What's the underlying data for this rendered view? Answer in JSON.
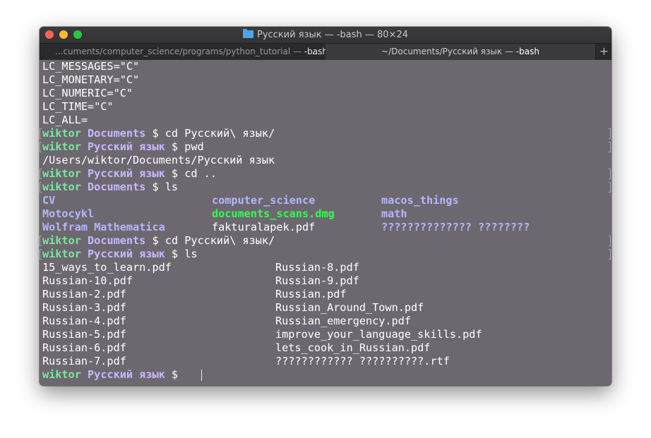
{
  "window": {
    "title": "Русский язык — -bash — 80×24",
    "folder_icon": "folder-icon"
  },
  "tabs": [
    {
      "label_path": "...cuments/computer_science/programs/python_tutorial — ",
      "label_cmd": "-bash",
      "active": false,
      "more": "..."
    },
    {
      "label_path": "~/Documents/Русский язык — ",
      "label_cmd": "-bash",
      "active": true
    }
  ],
  "new_tab_label": "+",
  "terminal": {
    "lines": {
      "l1": "LC_MESSAGES=\"C\"",
      "l2": "LC_MONETARY=\"C\"",
      "l3": "LC_NUMERIC=\"C\"",
      "l4": "LC_TIME=\"C\"",
      "l5": "LC_ALL=",
      "p1_user": "wiktor",
      "p1_dir": "Documents",
      "p1_cmd": "$ cd Русский\\ язык/",
      "p2_user": "wiktor",
      "p2_dir": "Русский язык",
      "p2_cmd": "$ pwd",
      "pwd_out": "/Users/wiktor/Documents/Русский язык",
      "p3_user": "wiktor",
      "p3_dir": "Русский язык",
      "p3_cmd": "$ cd ..",
      "p4_user": "wiktor",
      "p4_dir": "Documents",
      "p4_cmd": "$ ls",
      "p5_user": "wiktor",
      "p5_dir": "Documents",
      "p5_cmd": "$ cd Русский\\ язык/",
      "p6_user": "wiktor",
      "p6_dir": "Русский язык",
      "p6_cmd": "$ ls",
      "p7_user": "wiktor",
      "p7_dir": "Русский язык",
      "p7_cmd": "$"
    },
    "ls_documents": [
      [
        "CV",
        "computer_science",
        "macos_things"
      ],
      [
        "Motocykl",
        "documents_scans.dmg",
        "math"
      ],
      [
        "Wolfram Mathematica",
        "fakturalapek.pdf",
        "?????????????? ????????"
      ]
    ],
    "ls_russian": [
      [
        "15_ways_to_learn.pdf",
        "Russian-8.pdf"
      ],
      [
        "Russian-10.pdf",
        "Russian-9.pdf"
      ],
      [
        "Russian-2.pdf",
        "Russian.pdf"
      ],
      [
        "Russian-3.pdf",
        "Russian_Around_Town.pdf"
      ],
      [
        "Russian-4.pdf",
        "Russian_emergency.pdf"
      ],
      [
        "Russian-5.pdf",
        "improve_your_language_skills.pdf"
      ],
      [
        "Russian-6.pdf",
        "lets_cook_in_Russian.pdf"
      ],
      [
        "Russian-7.pdf",
        "???????????? ??????????.rtf"
      ]
    ]
  },
  "colors": {
    "terminal_bg": "#6d686f",
    "prompt_user": "#7be6a0",
    "prompt_dir": "#c8b7ff",
    "ls_directory": "#b4b6ff",
    "ls_archive": "#2fff4f"
  }
}
